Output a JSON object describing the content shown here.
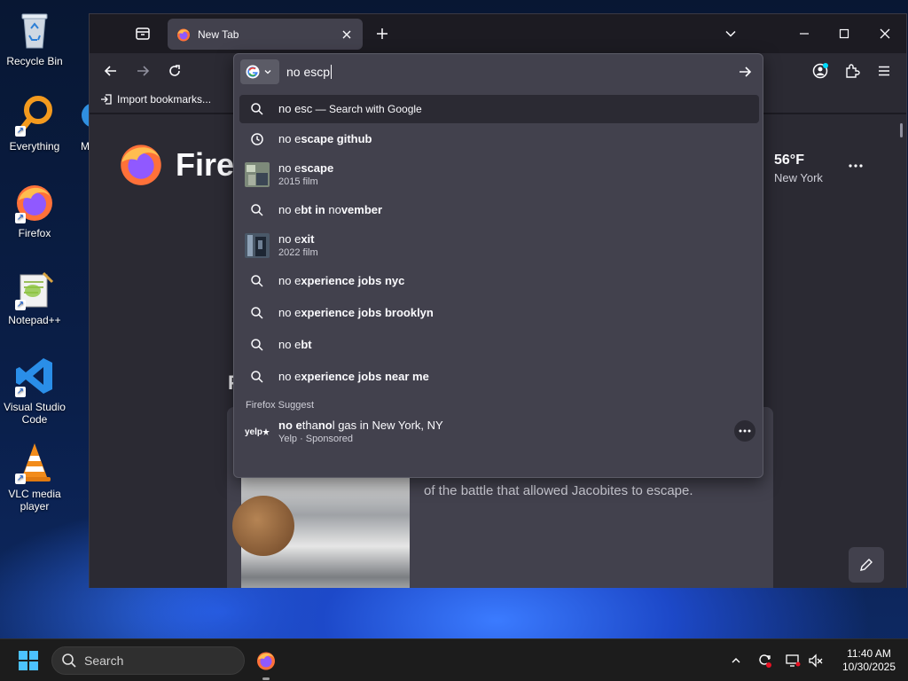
{
  "desktop": {
    "icons": [
      {
        "label": "Recycle Bin"
      },
      {
        "label": "Everything"
      },
      {
        "label": "Firefox"
      },
      {
        "label": "Notepad++"
      },
      {
        "label": "Visual Studio Code"
      },
      {
        "label": "VLC media player"
      }
    ],
    "partial_label": "M"
  },
  "browser": {
    "tab": {
      "title": "New Tab"
    },
    "bookmarks": {
      "import_label": "Import bookmarks..."
    },
    "newtab": {
      "brand_partial": "Firef",
      "weather": {
        "temp": "56°F",
        "city": "New York"
      },
      "partial_heading": "P",
      "story_text": "of the battle that allowed Jacobites to escape."
    },
    "urlbar": {
      "value": "no escp",
      "results": [
        {
          "type": "search",
          "query": "no esc",
          "aside": " — Search with Google"
        },
        {
          "type": "history",
          "typed": "no e",
          "bold": "scape github"
        },
        {
          "type": "entity",
          "typed": "no e",
          "bold": "scape",
          "sub": "2015 film"
        },
        {
          "type": "search",
          "typed": "no e",
          "bold": "bt in ",
          "rest": "no",
          "bold2": "vember"
        },
        {
          "type": "entity",
          "typed": "no e",
          "bold": "xit",
          "sub": "2022 film"
        },
        {
          "type": "search",
          "typed": "no e",
          "bold": "xperience jobs nyc"
        },
        {
          "type": "search",
          "typed": "no e",
          "bold": "xperience jobs brooklyn"
        },
        {
          "type": "search",
          "typed": "no e",
          "bold": "bt"
        },
        {
          "type": "search",
          "typed": "no e",
          "bold": "xperience jobs near me"
        }
      ],
      "group_label": "Firefox Suggest",
      "sponsored": {
        "t1": "no e",
        "b1": "tha",
        "t2": "no",
        "b2": "l",
        "t3": " gas in New York, NY",
        "sub": "Yelp · Sponsored",
        "logo": "yelp"
      }
    }
  },
  "taskbar": {
    "search_label": "Search",
    "time": "11:40 AM",
    "date": "10/30/2025"
  },
  "colors": {
    "accent": "#00ddff",
    "panel": "#42414d",
    "toolbar": "#2b2a33",
    "frame": "#1c1b22"
  }
}
